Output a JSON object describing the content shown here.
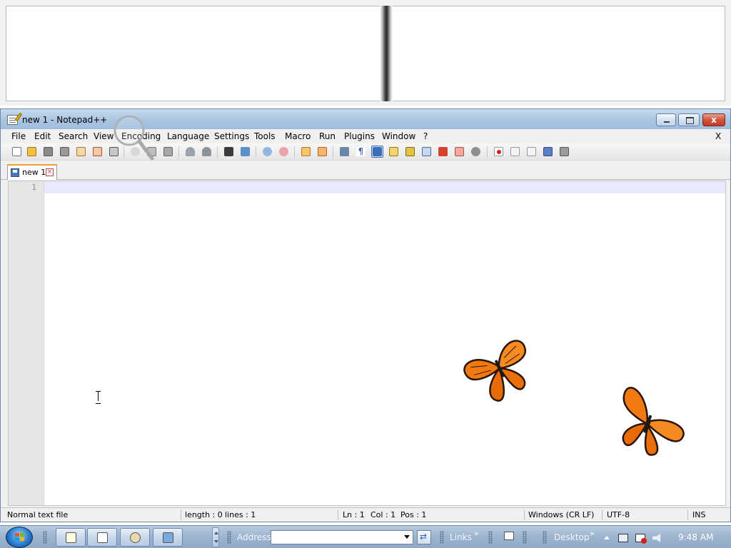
{
  "window": {
    "title": "new 1 - Notepad++",
    "close_glyph": "x"
  },
  "menu": {
    "items": [
      "File",
      "Edit",
      "Search",
      "View",
      "Encoding",
      "Language",
      "Settings",
      "Tools",
      "Macro",
      "Run",
      "Plugins",
      "Window",
      "?"
    ],
    "close_x": "X"
  },
  "toolbar": {
    "buttons": [
      "new-file-icon",
      "open-file-icon",
      "save-icon",
      "save-all-icon",
      "close-icon",
      "close-all-icon",
      "print-icon",
      "cut-icon",
      "copy-icon",
      "paste-icon",
      "undo-icon",
      "redo-icon",
      "find-icon",
      "replace-icon",
      "zoom-in-icon",
      "zoom-out-icon",
      "sync-vertical-icon",
      "sync-horizontal-icon",
      "word-wrap-icon",
      "show-all-chars-icon",
      "indent-guide-icon",
      "user-language-icon",
      "function-list-icon",
      "document-map-icon",
      "folder-as-workspace-icon",
      "monitoring-icon",
      "record-macro-icon",
      "stop-record-icon",
      "play-macro-icon",
      "run-macro-multiple-icon",
      "save-macro-icon"
    ],
    "selected": "indent-guide-icon"
  },
  "tabs": [
    {
      "label": "new 1",
      "close_glyph": "×"
    }
  ],
  "editor": {
    "line_numbers": [
      "1"
    ]
  },
  "status": {
    "file_type": "Normal text file",
    "length": "length : 0",
    "lines": "lines : 1",
    "ln": "Ln : 1",
    "col": "Col : 1",
    "pos": "Pos : 1",
    "eol": "Windows (CR LF)",
    "encoding": "UTF-8",
    "mode": "INS"
  },
  "taskbar": {
    "address_label": "Address",
    "address_value": "",
    "links_label": "Links",
    "desktop_label": "Desktop",
    "chevron": "»",
    "clock": "9:48 AM",
    "buttons": [
      "notepad-plus-plus",
      "media-player",
      "paint",
      "explorer"
    ]
  },
  "colors": {
    "title_gradient": "#a9c5e2",
    "current_line": "#e8e8ff",
    "gutter": "#e6e6e6",
    "butterfly_orange": "#f07a10",
    "taskbar": "#9fb6d0"
  }
}
